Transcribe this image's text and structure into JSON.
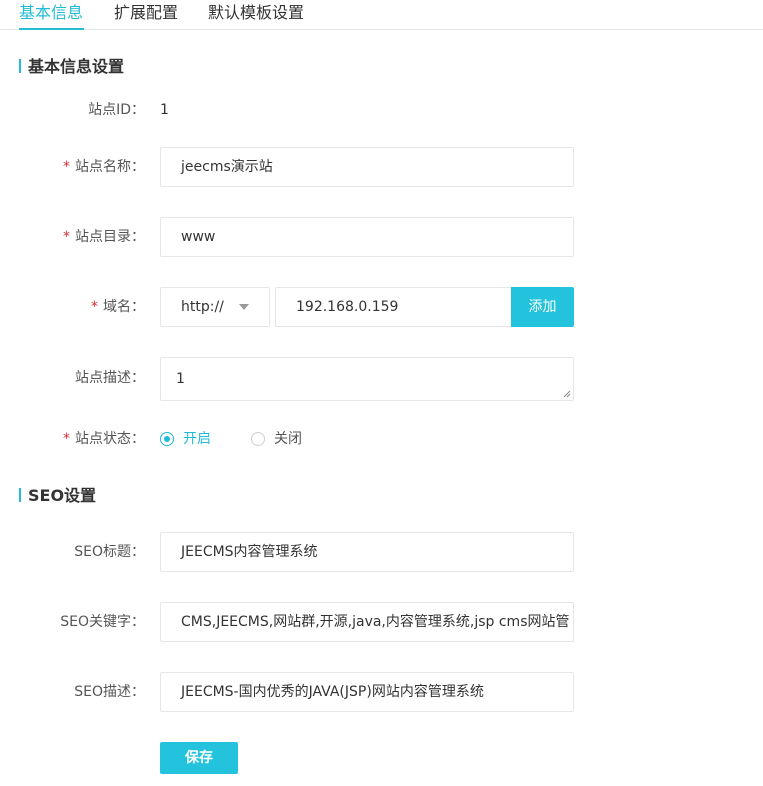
{
  "tabs": [
    {
      "label": "基本信息",
      "active": true
    },
    {
      "label": "扩展配置",
      "active": false
    },
    {
      "label": "默认模板设置",
      "active": false
    }
  ],
  "basic": {
    "section_title": "基本信息设置",
    "site_id_label": "站点ID：",
    "site_id_value": "1",
    "site_name_label": "站点名称：",
    "site_name_value": "jeecms演示站",
    "site_dir_label": "站点目录：",
    "site_dir_value": "www",
    "domain_label": "域名：",
    "protocol_value": "http://",
    "domain_value": "192.168.0.159",
    "add_button": "添加",
    "desc_label": "站点描述：",
    "desc_value": "1",
    "status_label": "站点状态：",
    "status_on": "开启",
    "status_off": "关闭",
    "status_selected": "开启",
    "required_mark": "*"
  },
  "seo": {
    "section_title": "SEO设置",
    "title_label": "SEO标题：",
    "title_value": "JEECMS内容管理系统",
    "keywords_label": "SEO关键字：",
    "keywords_value": "CMS,JEECMS,网站群,开源,java,内容管理系统,jsp cms网站管",
    "desc_label": "SEO描述：",
    "desc_value": "JEECMS-国内优秀的JAVA(JSP)网站内容管理系统"
  },
  "save_button": "保存",
  "colors": {
    "accent": "#23bcd6",
    "required": "#e02b2b"
  }
}
